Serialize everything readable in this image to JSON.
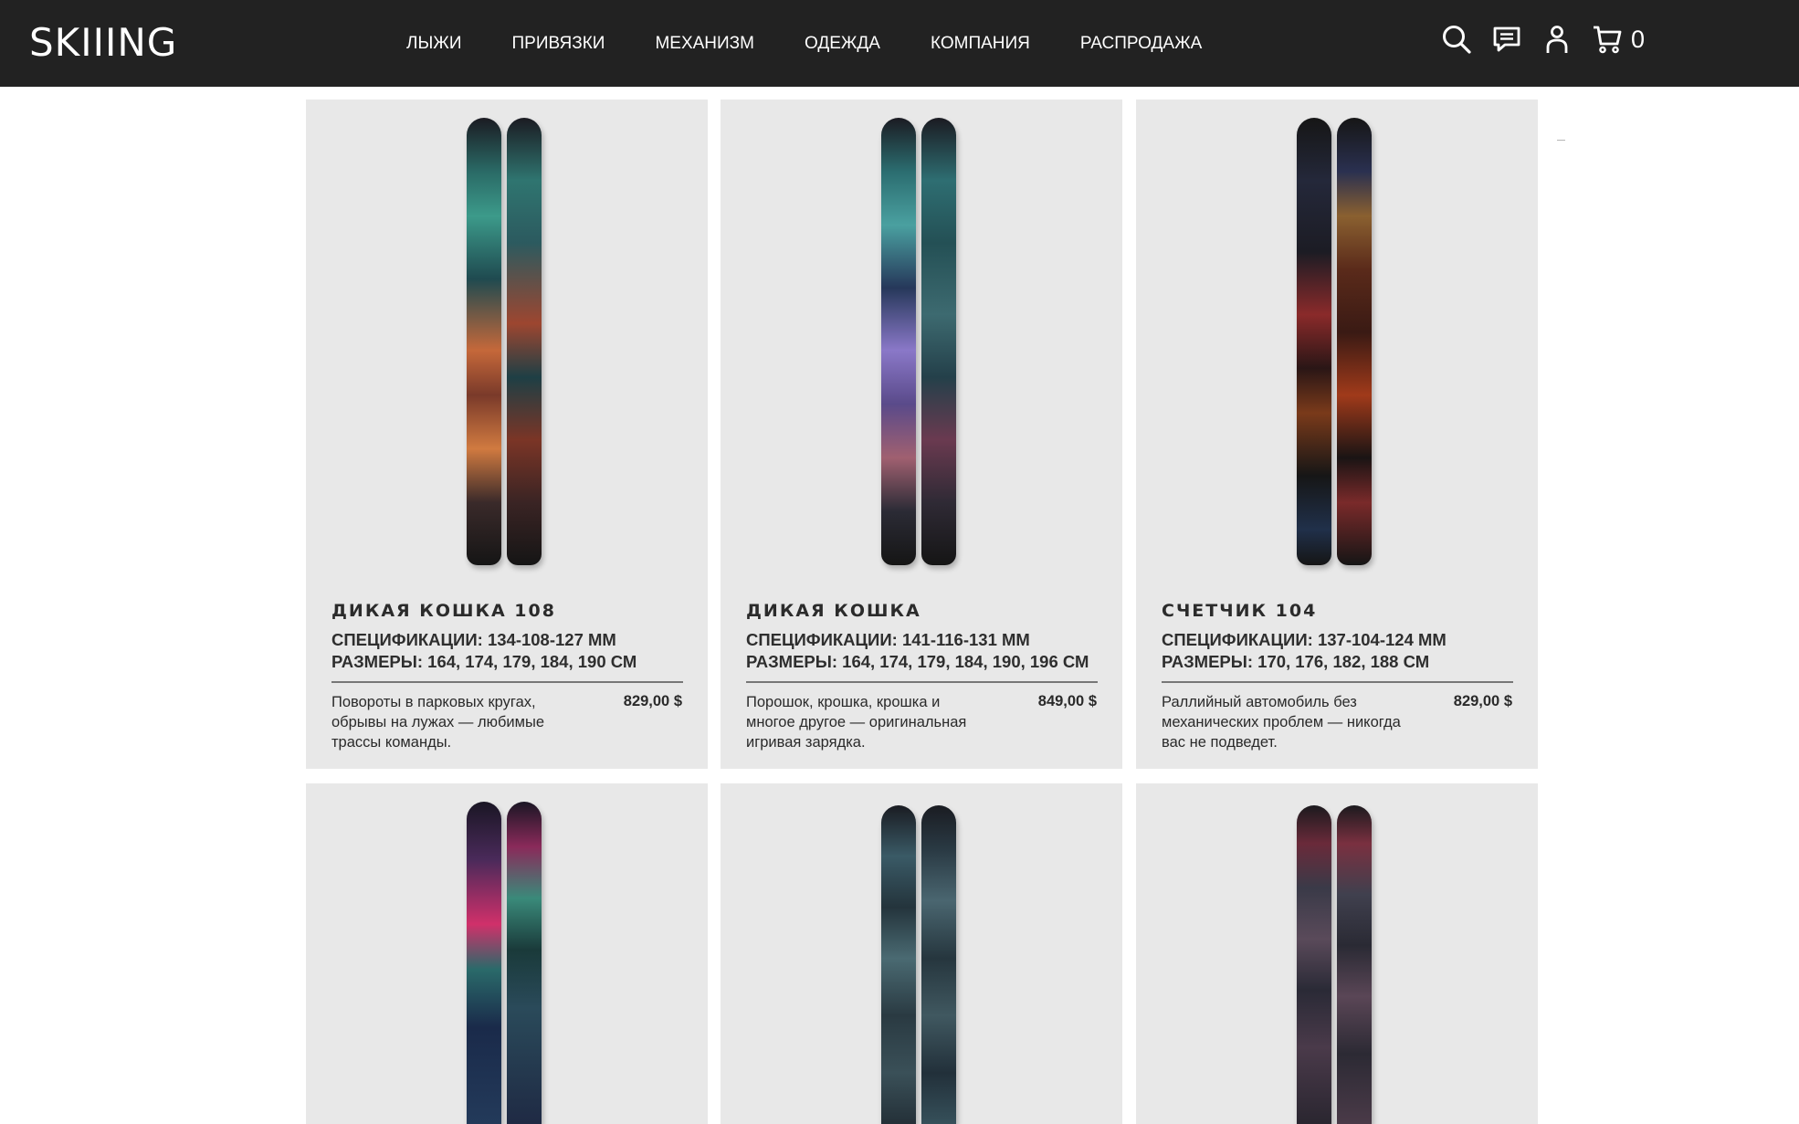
{
  "header": {
    "logo": "SKIIING",
    "nav": [
      "ЛЫЖИ",
      "ПРИВЯЗКИ",
      "МЕХАНИЗМ",
      "ОДЕЖДА",
      "КОМПАНИЯ",
      "РАСПРОДАЖА"
    ],
    "icons": [
      "search-icon",
      "chat-icon",
      "user-icon",
      "cart-icon"
    ],
    "cart_count": "0"
  },
  "colors": {
    "header_bg": "#222222",
    "card_bg": "#e8e8e8"
  },
  "products": [
    {
      "title": "ДИКАЯ КОШКА 108",
      "specs": "СПЕЦИФИКАЦИИ: 134-108-127 ММ",
      "sizes": "РАЗМЕРЫ: 164, 174, 179, 184, 190 СМ",
      "description": "Повороты в парковых кругах, обрывы на лужах — любимые трассы команды.",
      "price": "829,00 $"
    },
    {
      "title": "ДИКАЯ КОШКА",
      "specs": "СПЕЦИФИКАЦИИ: 141-116-131 ММ",
      "sizes": "РАЗМЕРЫ: 164, 174, 179, 184, 190, 196 СМ",
      "description": "Порошок, крошка, крошка и многое другое — оригинальная игривая зарядка.",
      "price": "849,00 $"
    },
    {
      "title": "СЧЕТЧИК 104",
      "specs": "СПЕЦИФИКАЦИИ: 137-104-124 ММ",
      "sizes": "РАЗМЕРЫ: 170, 176, 182, 188 СМ",
      "description": "Раллийный автомобиль без механических проблем — никогда вас не подведет.",
      "price": "829,00 $"
    }
  ]
}
